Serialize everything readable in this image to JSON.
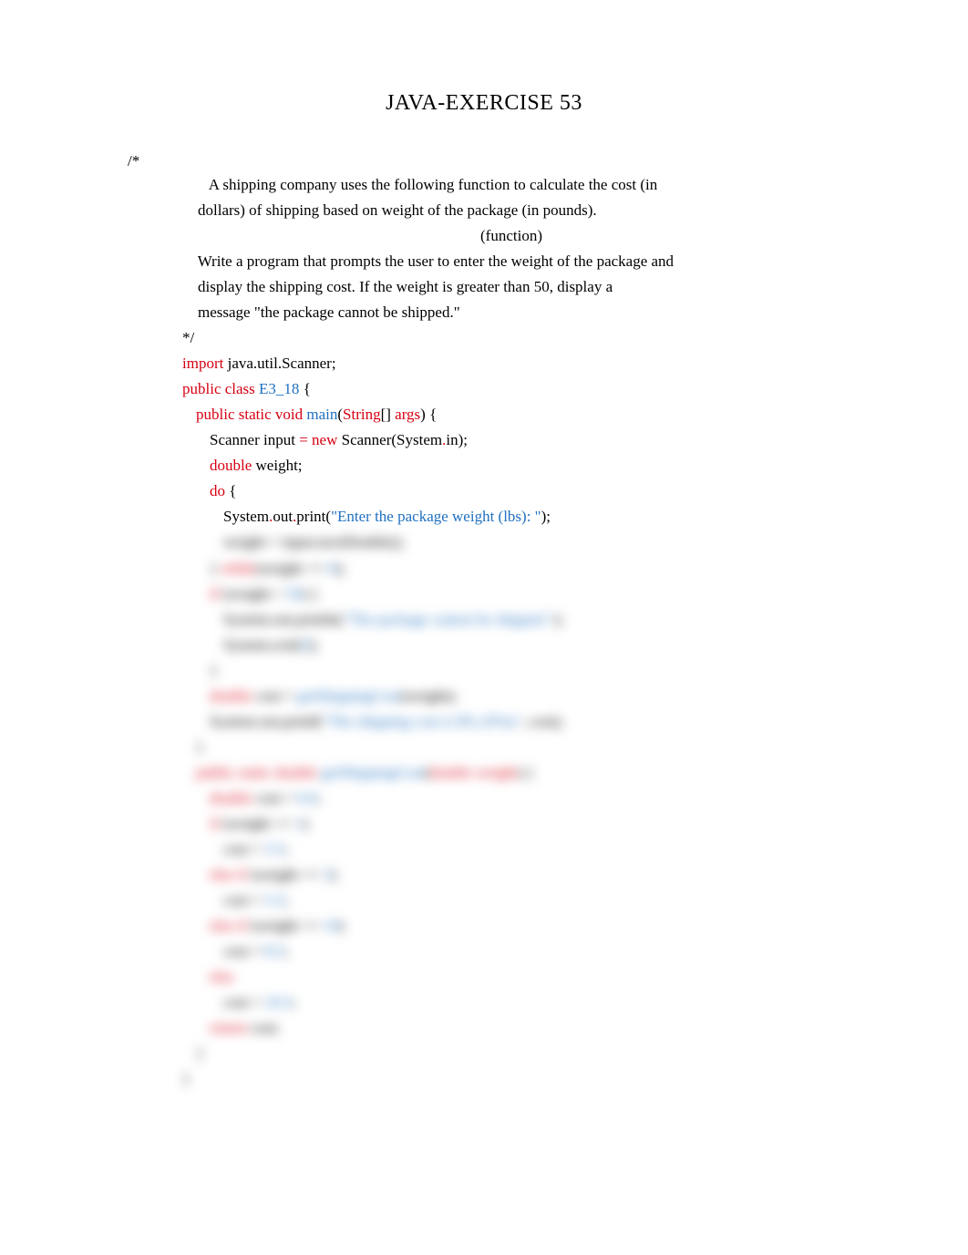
{
  "title": "JAVA-EXERCISE 53",
  "comment_open": "/*",
  "comment_lines": {
    "l1": "       A shipping company uses the following function to calculate the cost (in",
    "l2": "    dollars) of shipping based on weight of the package (in pounds).",
    "l3": "(function)",
    "l4": "    Write a program that prompts the user to enter the weight of the package and",
    "l5": "    display the shipping cost. If the weight is greater than 50, display a",
    "l6": "    message \"the package cannot be shipped.\"",
    "l7": "*/"
  },
  "code": {
    "import_kw": "import",
    "import_stmt": " java.util.Scanner;",
    "public_class_kw": "public class ",
    "class_name": "E3_18",
    "open_brace": " {",
    "psv": "public static void ",
    "main": "main",
    "main_paren_open": "(",
    "string_type": "String",
    "brackets": "[] ",
    "args": "args",
    "main_paren_close": ") {",
    "scanner_decl_a": "Scanner input ",
    "new_kw": "= new",
    "scanner_decl_b": " Scanner(System",
    "dot1": ".",
    "in_close": "in);",
    "double_kw": "double",
    "weight_decl": " weight;",
    "do_kw": "do",
    "do_brace": " {",
    "system_a": "System",
    "out_a": "out",
    "print_a": "print(",
    "prompt_str": "\"Enter the package weight (lbs): \"",
    "close_paren_a": ");"
  },
  "blurred_lines": {
    "b1": "weight = input.nextDouble();",
    "b2": "} while(weight <= 0);",
    "b3": "if (weight > 50) {",
    "b4_a": "System.out.println(",
    "b4_str": "\"The package cannot be shipped.\"",
    "b4_b": ");",
    "b5": "System.exit(0);",
    "b6": "}",
    "b7_a": "double",
    "b7_b": " cost = ",
    "b7_c": "getShippingCost(weight);",
    "b8_a": "System.out.printf(",
    "b8_str": "\"The shipping cost is $%.2f%n\"",
    "b8_b": ", cost);",
    "b9": "}",
    "b10_a": "public static double",
    "b10_b": " getShippingCost",
    "b10_c": "(",
    "b10_d": "double",
    "b10_e": " weight",
    "b10_f": ") {",
    "b11_a": "double",
    "b11_b": " cost = ",
    "b11_c": "0.0",
    "b11_d": ";",
    "b12_a": "if",
    "b12_b": " (weight <= ",
    "b12_c": "1",
    "b12_d": ")",
    "b13_a": "cost = ",
    "b13_b": "3.5",
    "b13_c": ";",
    "b14_a": "else if",
    "b14_b": " (weight <= ",
    "b14_c": "3",
    "b14_d": ")",
    "b15_a": "cost = ",
    "b15_b": "5.5",
    "b15_c": ";",
    "b16_a": "else if",
    "b16_b": " (weight <= ",
    "b16_c": "10",
    "b16_d": ")",
    "b17_a": "cost = ",
    "b17_b": "8.5",
    "b17_c": ";",
    "b18_a": "else",
    "b19_a": "cost = ",
    "b19_b": "10.5",
    "b19_c": ";",
    "b20_a": "return",
    "b20_b": " cost;",
    "b21": "}",
    "b22": "}"
  }
}
